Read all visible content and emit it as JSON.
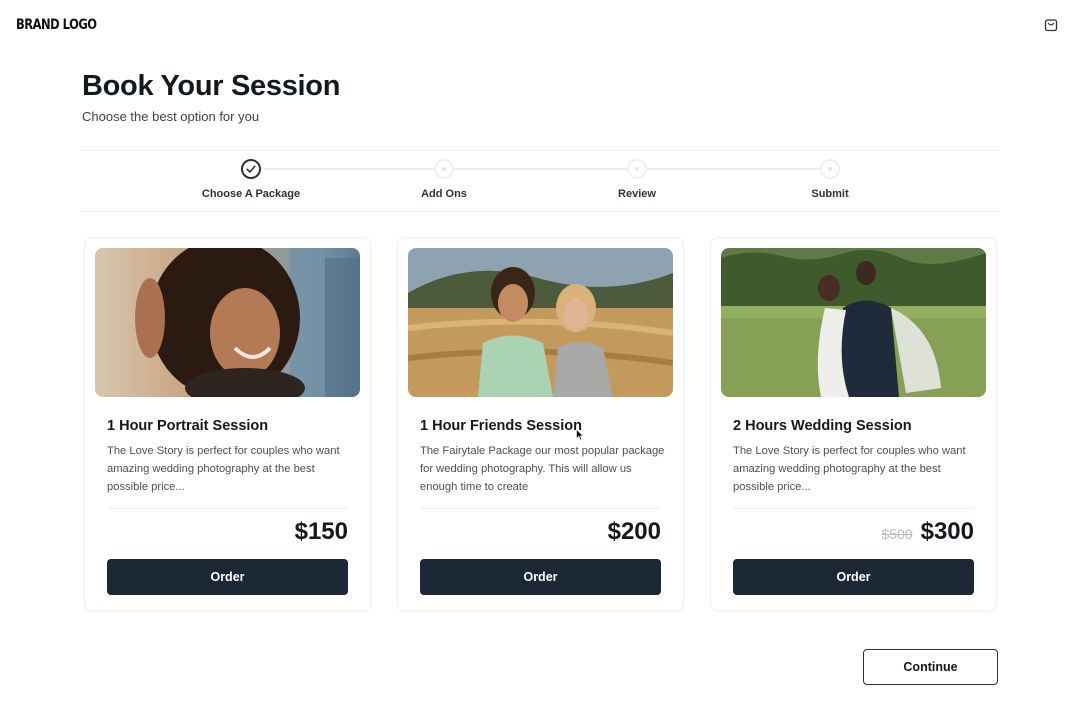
{
  "header": {
    "brand": "BRAND LOGO",
    "cart_icon": "shopping-bag-icon"
  },
  "page": {
    "title": "Book Your Session",
    "subtitle": "Choose the best option for you"
  },
  "stepper": {
    "steps": [
      {
        "label": "Choose A Package",
        "status": "completed",
        "icon": "check-icon"
      },
      {
        "label": "Add Ons",
        "status": "pending"
      },
      {
        "label": "Review",
        "status": "pending"
      },
      {
        "label": "Submit",
        "status": "pending"
      }
    ]
  },
  "packages": [
    {
      "title": "1 Hour Portrait Session",
      "description": "The Love Story is perfect for couples who want amazing wedding photography at the best possible price...",
      "price": "$150",
      "old_price": "",
      "button": "Order",
      "image": "portrait-photo"
    },
    {
      "title": "1 Hour Friends Session",
      "description": "The Fairytale Package our most popular package for wedding photography. This will allow us enough time to create",
      "price": "$200",
      "old_price": "",
      "button": "Order",
      "image": "friends-photo"
    },
    {
      "title": "2 Hours Wedding Session",
      "description": "The Love Story is perfect for couples who want amazing wedding photography at the best possible price...",
      "price": "$300",
      "old_price": "$500",
      "button": "Order",
      "image": "wedding-photo"
    }
  ],
  "footer": {
    "continue": "Continue"
  },
  "colors": {
    "primary_button": "#1d2836",
    "text_dark": "#14181f",
    "muted": "#b7bcc3",
    "border": "#eceef1"
  }
}
